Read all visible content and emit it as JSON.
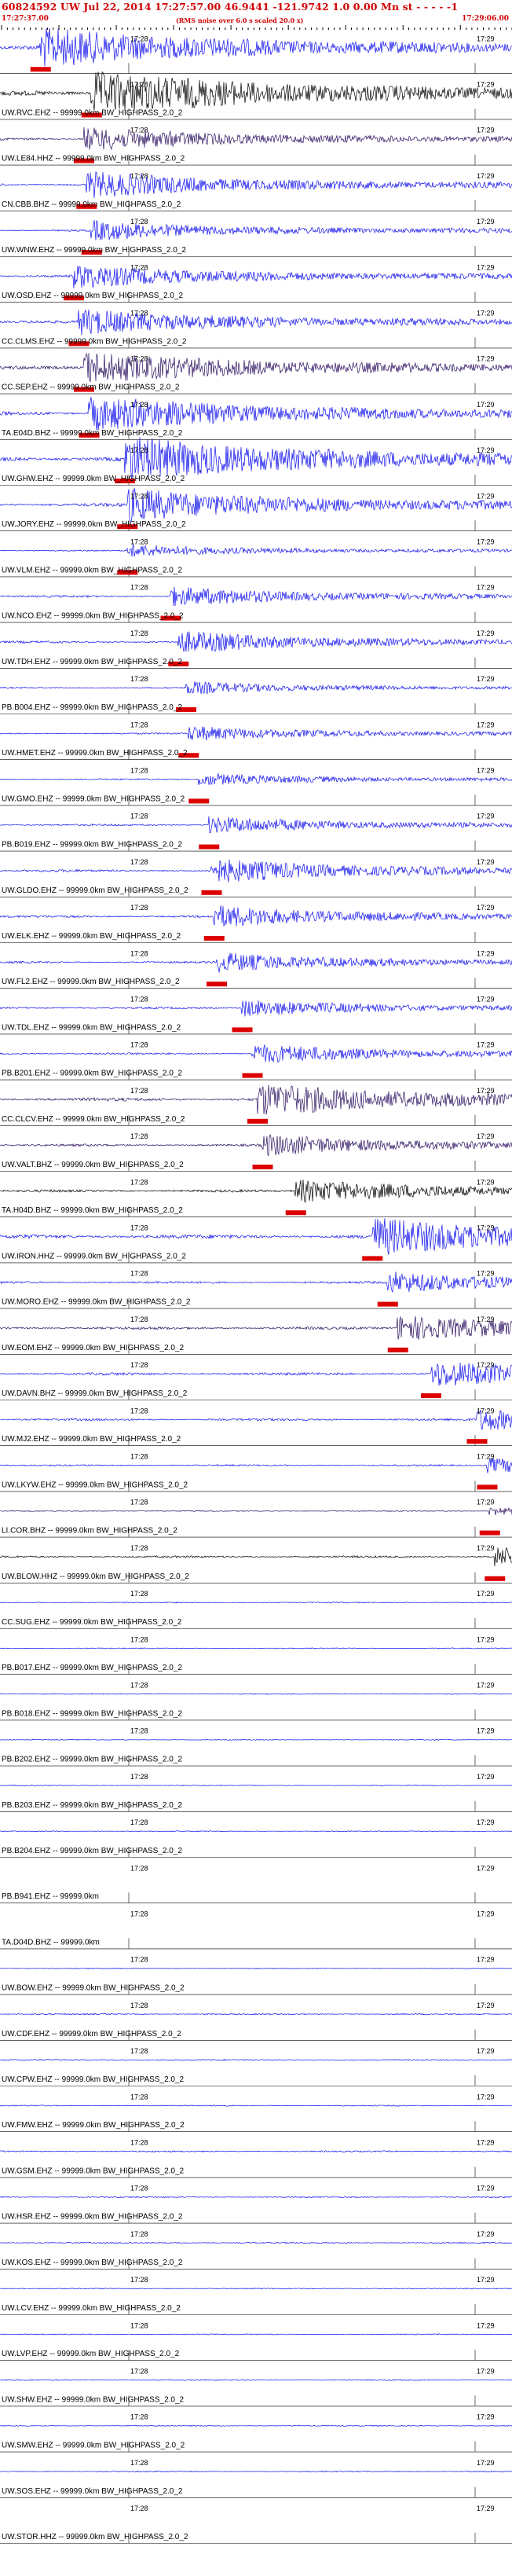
{
  "header": {
    "title": "60824592 UW Jul 22, 2014 17:27:57.00    46.9441 -121.9742   1.0 0.00 Mn st  - - - -  -1",
    "start_time": "17:27:37.00",
    "end_time": "17:29:06.00",
    "note": "(RMS noise over 6.0 s scaled 20.0 x)"
  },
  "colors": {
    "trace_blue": "#1010ee",
    "trace_dark": "#2a0f60",
    "trace_black": "#000000",
    "pick_red": "#dd0000",
    "text_red": "#d00000"
  },
  "chart_data": {
    "type": "seismogram",
    "tick_labels": [
      "17:28",
      "17:29"
    ],
    "traces": [
      {
        "label": "",
        "pick": 0.075,
        "amp": 0.9,
        "color": "blue"
      },
      {
        "label": "UW.RVC.EHZ -- 99999.0km BW_HIGHPASS_2.0_2",
        "pick": 0.175,
        "amp": 1.0,
        "color": "black"
      },
      {
        "label": "UW.LE84.HHZ -- 99999.0km BW_HIGHPASS_2.0_2",
        "pick": 0.16,
        "amp": 0.55,
        "color": "dark"
      },
      {
        "label": "CN.CBB.BHZ -- 99999.0km BW_HIGHPASS_2.0_2",
        "pick": 0.165,
        "amp": 0.6,
        "color": "blue"
      },
      {
        "label": "UW.WNW.EHZ -- 99999.0km BW_HIGHPASS_2.0_2",
        "pick": 0.175,
        "amp": 0.45,
        "color": "blue"
      },
      {
        "label": "UW.OSD.EHZ -- 99999.0km BW_HIGHPASS_2.0_2",
        "pick": 0.14,
        "amp": 0.55,
        "color": "blue"
      },
      {
        "label": "CC.CLMS.EHZ -- 99999.0km BW_HIGHPASS_2.0_2",
        "pick": 0.15,
        "amp": 0.6,
        "color": "blue"
      },
      {
        "label": "CC.SEP.EHZ -- 99999.0km BW_HIGHPASS_2.0_2",
        "pick": 0.16,
        "amp": 0.75,
        "color": "dark"
      },
      {
        "label": "TA.E04D.BHZ -- 99999.0km BW_HIGHPASS_2.0_2",
        "pick": 0.17,
        "amp": 0.8,
        "color": "blue"
      },
      {
        "label": "UW.GHW.EHZ -- 99999.0km BW_HIGHPASS_2.0_2",
        "pick": 0.24,
        "amp": 1.0,
        "color": "blue"
      },
      {
        "label": "UW.JORY.EHZ -- 99999.0km BW_HIGHPASS_2.0_2",
        "pick": 0.245,
        "amp": 0.75,
        "color": "blue"
      },
      {
        "label": "UW.VLM.EHZ -- 99999.0km BW_HIGHPASS_2.0_2",
        "pick": 0.245,
        "amp": 0.3,
        "color": "blue"
      },
      {
        "label": "UW.NCO.EHZ -- 99999.0km BW_HIGHPASS_2.0_2",
        "pick": 0.33,
        "amp": 0.45,
        "color": "blue"
      },
      {
        "label": "UW.TDH.EHZ -- 99999.0km BW_HIGHPASS_2.0_2",
        "pick": 0.345,
        "amp": 0.5,
        "color": "blue"
      },
      {
        "label": "PB.B004.EHZ -- 99999.0km BW_HIGHPASS_2.0_2",
        "pick": 0.36,
        "amp": 0.3,
        "color": "blue"
      },
      {
        "label": "UW.HMET.EHZ -- 99999.0km BW_HIGHPASS_2.0_2",
        "pick": 0.365,
        "amp": 0.35,
        "color": "blue"
      },
      {
        "label": "UW.GMO.EHZ -- 99999.0km BW_HIGHPASS_2.0_2",
        "pick": 0.385,
        "amp": 0.3,
        "color": "blue"
      },
      {
        "label": "PB.B019.EHZ -- 99999.0km BW_HIGHPASS_2.0_2",
        "pick": 0.405,
        "amp": 0.4,
        "color": "blue"
      },
      {
        "label": "UW.GLDO.EHZ -- 99999.0km BW_HIGHPASS_2.0_2",
        "pick": 0.41,
        "amp": 0.55,
        "color": "blue"
      },
      {
        "label": "UW.ELK.EHZ -- 99999.0km BW_HIGHPASS_2.0_2",
        "pick": 0.415,
        "amp": 0.5,
        "color": "blue"
      },
      {
        "label": "UW.FL2.EHZ -- 99999.0km BW_HIGHPASS_2.0_2",
        "pick": 0.42,
        "amp": 0.45,
        "color": "blue"
      },
      {
        "label": "UW.TDL.EHZ -- 99999.0km BW_HIGHPASS_2.0_2",
        "pick": 0.47,
        "amp": 0.4,
        "color": "blue"
      },
      {
        "label": "PB.B201.EHZ -- 99999.0km BW_HIGHPASS_2.0_2",
        "pick": 0.49,
        "amp": 0.45,
        "color": "blue"
      },
      {
        "label": "CC.CLCV.EHZ -- 99999.0km BW_HIGHPASS_2.0_2",
        "pick": 0.5,
        "amp": 0.75,
        "color": "dark"
      },
      {
        "label": "UW.VALT.BHZ -- 99999.0km BW_HIGHPASS_2.0_2",
        "pick": 0.51,
        "amp": 0.5,
        "color": "dark"
      },
      {
        "label": "TA.H04D.BHZ -- 99999.0km BW_HIGHPASS_2.0_2",
        "pick": 0.575,
        "amp": 0.55,
        "color": "black"
      },
      {
        "label": "UW.IRON.HHZ -- 99999.0km BW_HIGHPASS_2.0_2",
        "pick": 0.725,
        "amp": 0.85,
        "color": "blue"
      },
      {
        "label": "UW.MORO.EHZ -- 99999.0km BW_HIGHPASS_2.0_2",
        "pick": 0.755,
        "amp": 0.5,
        "color": "blue"
      },
      {
        "label": "UW.EOM.EHZ -- 99999.0km BW_HIGHPASS_2.0_2",
        "pick": 0.775,
        "amp": 0.6,
        "color": "dark"
      },
      {
        "label": "UW.DAVN.BHZ -- 99999.0km BW_HIGHPASS_2.0_2",
        "pick": 0.84,
        "amp": 0.6,
        "color": "blue"
      },
      {
        "label": "UW.MJ2.EHZ -- 99999.0km BW_HIGHPASS_2.0_2",
        "pick": 0.93,
        "amp": 0.5,
        "color": "blue"
      },
      {
        "label": "UW.LKYW.EHZ -- 99999.0km BW_HIGHPASS_2.0_2",
        "pick": 0.95,
        "amp": 0.35,
        "color": "blue"
      },
      {
        "label": "LI.COR.BHZ -- 99999.0km BW_HIGHPASS_2.0_2",
        "pick": 0.955,
        "amp": 0.2,
        "color": "dark"
      },
      {
        "label": "UW.BLOW.HHZ -- 99999.0km BW_HIGHPASS_2.0_2",
        "pick": 0.965,
        "amp": 0.45,
        "color": "black"
      },
      {
        "label": "CC.SUG.EHZ -- 99999.0km BW_HIGHPASS_2.0_2",
        "pick": null,
        "amp": 0.25,
        "color": "blue"
      },
      {
        "label": "PB.B017.EHZ -- 99999.0km BW_HIGHPASS_2.0_2",
        "pick": null,
        "amp": 0.2,
        "color": "blue"
      },
      {
        "label": "PB.B018.EHZ -- 99999.0km BW_HIGHPASS_2.0_2",
        "pick": null,
        "amp": 0.18,
        "color": "blue"
      },
      {
        "label": "PB.B202.EHZ -- 99999.0km BW_HIGHPASS_2.0_2",
        "pick": null,
        "amp": 0.18,
        "color": "blue"
      },
      {
        "label": "PB.B203.EHZ -- 99999.0km BW_HIGHPASS_2.0_2",
        "pick": null,
        "amp": 0.2,
        "color": "blue"
      },
      {
        "label": "PB.B204.EHZ -- 99999.0km BW_HIGHPASS_2.0_2",
        "pick": null,
        "amp": 0.18,
        "color": "blue"
      },
      {
        "label": "PB.B941.EHZ -- 99999.0km",
        "pick": null,
        "amp": 0.0,
        "color": "blue"
      },
      {
        "label": "TA.D04D.BHZ -- 99999.0km",
        "pick": null,
        "amp": 0.0,
        "color": "blue"
      },
      {
        "label": "UW.BOW.EHZ -- 99999.0km BW_HIGHPASS_2.0_2",
        "pick": null,
        "amp": 0.18,
        "color": "blue"
      },
      {
        "label": "UW.CDF.EHZ -- 99999.0km BW_HIGHPASS_2.0_2",
        "pick": null,
        "amp": 0.3,
        "color": "blue"
      },
      {
        "label": "UW.CPW.EHZ -- 99999.0km BW_HIGHPASS_2.0_2",
        "pick": null,
        "amp": 0.22,
        "color": "blue"
      },
      {
        "label": "UW.FMW.EHZ -- 99999.0km BW_HIGHPASS_2.0_2",
        "pick": null,
        "amp": 0.25,
        "color": "blue"
      },
      {
        "label": "UW.GSM.EHZ -- 99999.0km BW_HIGHPASS_2.0_2",
        "pick": null,
        "amp": 0.3,
        "color": "blue"
      },
      {
        "label": "UW.HSR.EHZ -- 99999.0km BW_HIGHPASS_2.0_2",
        "pick": null,
        "amp": 0.3,
        "color": "blue"
      },
      {
        "label": "UW.KOS.EHZ -- 99999.0km BW_HIGHPASS_2.0_2",
        "pick": null,
        "amp": 0.28,
        "color": "blue"
      },
      {
        "label": "UW.LCV.EHZ -- 99999.0km BW_HIGHPASS_2.0_2",
        "pick": null,
        "amp": 0.2,
        "color": "blue"
      },
      {
        "label": "UW.LVP.EHZ -- 99999.0km BW_HIGHPASS_2.0_2",
        "pick": null,
        "amp": 0.22,
        "color": "blue"
      },
      {
        "label": "UW.SHW.EHZ -- 99999.0km BW_HIGHPASS_2.0_2",
        "pick": null,
        "amp": 0.25,
        "color": "blue"
      },
      {
        "label": "UW.SMW.EHZ -- 99999.0km BW_HIGHPASS_2.0_2",
        "pick": null,
        "amp": 0.22,
        "color": "blue"
      },
      {
        "label": "UW.SOS.EHZ -- 99999.0km BW_HIGHPASS_2.0_2",
        "pick": null,
        "amp": 0.25,
        "color": "blue"
      },
      {
        "label": "UW.STOR.HHZ -- 99999.0km BW_HIGHPASS_2.0_2",
        "pick": null,
        "amp": 0.0,
        "color": "blue"
      }
    ]
  }
}
